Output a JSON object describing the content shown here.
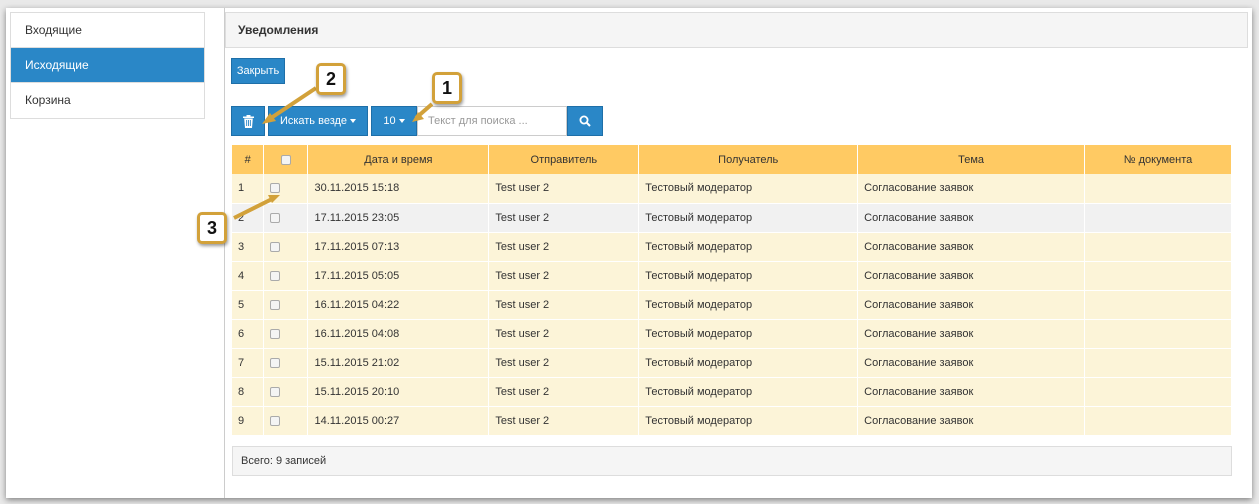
{
  "sidebar": {
    "items": [
      {
        "label": "Входящие"
      },
      {
        "label": "Исходящие"
      },
      {
        "label": "Корзина"
      }
    ]
  },
  "panel": {
    "title": "Уведомления"
  },
  "toolbar": {
    "close_label": "Закрыть",
    "search_where_label": "Искать везде",
    "page_size_label": "10",
    "search_placeholder": "Текст для поиска ...",
    "trash_icon": "trash-icon",
    "search_icon": "search-icon"
  },
  "table": {
    "headers": [
      "#",
      "",
      "Дата и время",
      "Отправитель",
      "Получатель",
      "Тема",
      "№ документа"
    ],
    "rows": [
      {
        "n": "1",
        "date": "30.11.2015 15:18",
        "sender": "Test user 2",
        "recipient": "Тестовый модератор",
        "subject": "Согласование заявок",
        "doc": ""
      },
      {
        "n": "2",
        "date": "17.11.2015 23:05",
        "sender": "Test user 2",
        "recipient": "Тестовый модератор",
        "subject": "Согласование заявок",
        "doc": ""
      },
      {
        "n": "3",
        "date": "17.11.2015 07:13",
        "sender": "Test user 2",
        "recipient": "Тестовый модератор",
        "subject": "Согласование заявок",
        "doc": ""
      },
      {
        "n": "4",
        "date": "17.11.2015 05:05",
        "sender": "Test user 2",
        "recipient": "Тестовый модератор",
        "subject": "Согласование заявок",
        "doc": ""
      },
      {
        "n": "5",
        "date": "16.11.2015 04:22",
        "sender": "Test user 2",
        "recipient": "Тестовый модератор",
        "subject": "Согласование заявок",
        "doc": ""
      },
      {
        "n": "6",
        "date": "16.11.2015 04:08",
        "sender": "Test user 2",
        "recipient": "Тестовый модератор",
        "subject": "Согласование заявок",
        "doc": ""
      },
      {
        "n": "7",
        "date": "15.11.2015 21:02",
        "sender": "Test user 2",
        "recipient": "Тестовый модератор",
        "subject": "Согласование заявок",
        "doc": ""
      },
      {
        "n": "8",
        "date": "15.11.2015 20:10",
        "sender": "Test user 2",
        "recipient": "Тестовый модератор",
        "subject": "Согласование заявок",
        "doc": ""
      },
      {
        "n": "9",
        "date": "14.11.2015 00:27",
        "sender": "Test user 2",
        "recipient": "Тестовый модератор",
        "subject": "Согласование заявок",
        "doc": ""
      }
    ]
  },
  "footer": {
    "total": "Всего: 9 записей"
  },
  "callouts": {
    "c1": "1",
    "c2": "2",
    "c3": "3"
  },
  "colors": {
    "accent": "#2a87c7",
    "header": "#ffca63",
    "row": "#fcf4d8",
    "callout_border": "#d2a13a"
  }
}
